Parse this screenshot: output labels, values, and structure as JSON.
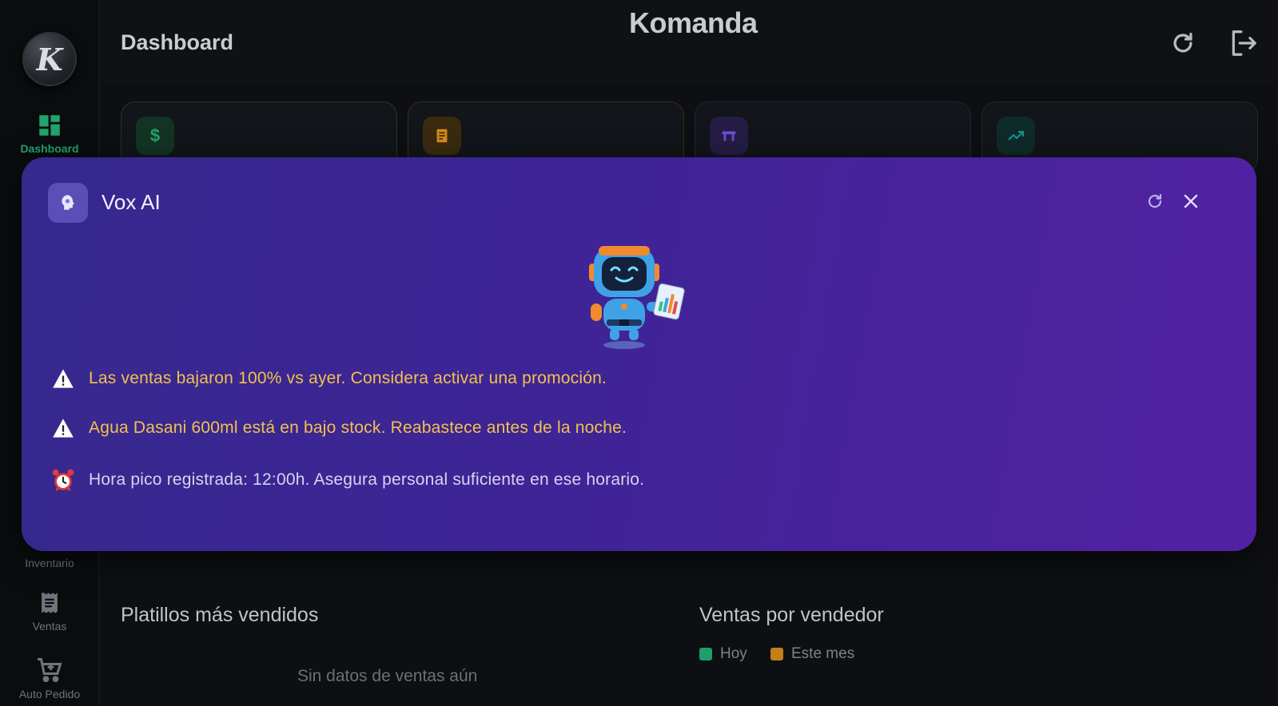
{
  "app": {
    "brand": "Komanda",
    "logo_letter": "K",
    "page_title": "Dashboard"
  },
  "sidebar": {
    "items": [
      {
        "label": "Dashboard",
        "icon": "dashboard-icon",
        "active": true
      },
      {
        "label": "Inventario",
        "icon": "inventory-icon",
        "active": false
      },
      {
        "label": "Ventas",
        "icon": "receipt-icon",
        "active": false
      },
      {
        "label": "Auto Pedido",
        "icon": "cart-icon",
        "active": false
      }
    ]
  },
  "header": {
    "refresh_icon": "refresh-icon",
    "logout_icon": "logout-icon"
  },
  "stat_cards": [
    {
      "icon": "dollar-icon",
      "glyph": "$",
      "color": "#22a36b"
    },
    {
      "icon": "receipt-icon",
      "glyph": "",
      "color": "#d58a1a"
    },
    {
      "icon": "table-icon",
      "glyph": "",
      "color": "#6b4fd8"
    },
    {
      "icon": "trend-up-icon",
      "glyph": "",
      "color": "#1b8f8a"
    }
  ],
  "sections": {
    "top_dishes": {
      "title": "Platillos más vendidos",
      "empty": "Sin datos de ventas aún"
    },
    "sales_by_seller": {
      "title": "Ventas por vendedor",
      "legend": [
        {
          "label": "Hoy",
          "color": "#1f9e6a"
        },
        {
          "label": "Este mes",
          "color": "#c47f16"
        }
      ]
    }
  },
  "vox_modal": {
    "title": "Vox AI",
    "icon": "brain-icon",
    "insights": [
      {
        "type": "warning",
        "icon": "warning-icon",
        "text": "Las ventas bajaron 100% vs ayer. Considera activar una promoción."
      },
      {
        "type": "warning",
        "icon": "warning-icon",
        "text": "Agua Dasani 600ml está en bajo stock. Reabastece antes de la noche."
      },
      {
        "type": "info",
        "icon": "alarm-clock-icon",
        "text": "Hora pico registrada: 12:00h. Asegura personal suficiente en ese horario."
      }
    ]
  }
}
